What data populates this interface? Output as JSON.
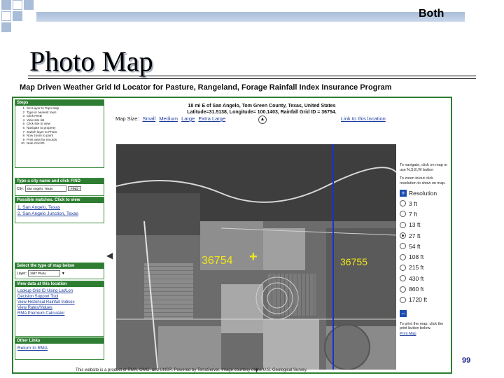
{
  "slide": {
    "corner_label": "Both",
    "title": "Photo Map",
    "page_number": "99"
  },
  "app": {
    "title": "Map Driven Weather Grid Id Locator for Pasture, Rangeland, Forage Rainfall Index Insurance Program",
    "location_line1": "18 mi E of San Angelo, Tom Green County, Texas, United States",
    "location_line2": "Latitude=31.5138, Longitude= 100.1403, Rainfall Grid ID = 36754.",
    "map_size_label": "Map Size:",
    "map_size_options": [
      "Small",
      "Medium",
      "Large",
      "Extra Large"
    ],
    "link_to_location": "Link to this location",
    "footer": "This website is a product of RMA, OMG, and UNSR. Powered by TerraServer. Image courtesy of the U.S. Geological Survey."
  },
  "sidebar": {
    "steps_header": "Steps",
    "steps": [
      {
        "n": "1",
        "text": "Set Layer to Topo Map"
      },
      {
        "n": "2",
        "text": "Type in nearest town"
      },
      {
        "n": "3",
        "text": "Click FIND"
      },
      {
        "n": "4",
        "text": "View site list"
      },
      {
        "n": "5",
        "text": "Click site to view"
      },
      {
        "n": "6",
        "text": "Navigate to property"
      },
      {
        "n": "7",
        "text": "Switch layer to Photo"
      },
      {
        "n": "8",
        "text": "Now zoom to point"
      },
      {
        "n": "9",
        "text": "Print view for records"
      },
      {
        "n": "10",
        "text": "Note Grid ID"
      }
    ],
    "city_header": "Type a city name and click FIND",
    "city_label": "City:",
    "city_value": "San Angelo, Texas",
    "find_button": "FIND",
    "matches_header": "Possible matches. Click to view",
    "matches": [
      "1. San Angelo, Texas",
      "2. San Angelo Junction, Texas"
    ],
    "maptype_header": "Select the type of map below",
    "layer_label": "Layer:",
    "layer_value": "1997 Photo",
    "view_header": "View data at this location",
    "view_links": [
      "Lookup Grid ID Using Lat/Lon",
      "Decision Support Tool",
      "View Historical Rainfall Indices",
      "View Rates/Values",
      "RMA Premium Calculator"
    ],
    "other_header": "Other Links",
    "other_links": [
      "Return to RMA"
    ]
  },
  "map": {
    "grid_left": "36754",
    "grid_right": "36755",
    "marker_color": "#f2e51a",
    "grid_line_color": "#1a2fd6"
  },
  "right_panel": {
    "navigate_note": "To navigate, click on map or use N,S,E,W button",
    "zoom_note": "To zoom in/out click resolution to show on map.",
    "resolution_label": "Resolution",
    "resolutions": [
      "3 ft",
      "7 ft",
      "13 ft",
      "27 ft",
      "54 ft",
      "108 ft",
      "215 ft",
      "430 ft",
      "860 ft",
      "1720 ft"
    ],
    "selected_resolution": "27 ft",
    "print_note": "To print the map, click the print button below.",
    "print_link": "Print Map"
  },
  "colors": {
    "title_bar": "#a9bdd8",
    "frame_green": "#2e7d32",
    "link_blue": "#1a3a9c",
    "page_number": "#1c2a8c"
  }
}
